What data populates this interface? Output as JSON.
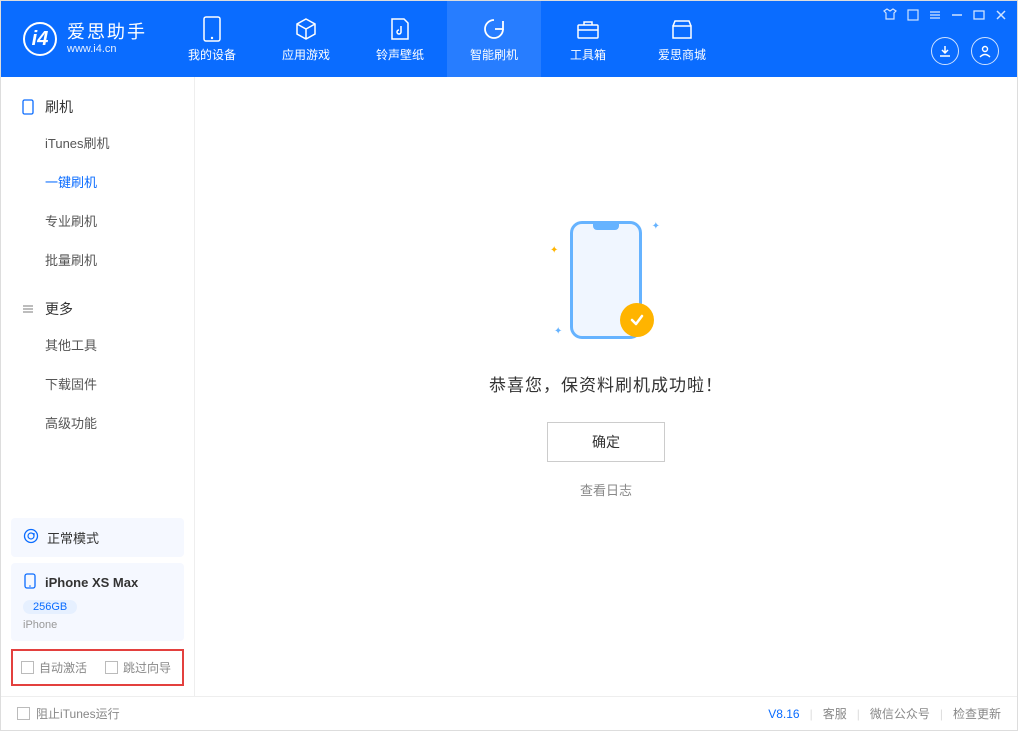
{
  "brand": {
    "name": "爱思助手",
    "url": "www.i4.cn"
  },
  "tabs": [
    {
      "label": "我的设备"
    },
    {
      "label": "应用游戏"
    },
    {
      "label": "铃声壁纸"
    },
    {
      "label": "智能刷机"
    },
    {
      "label": "工具箱"
    },
    {
      "label": "爱思商城"
    }
  ],
  "sidebar": {
    "section1": {
      "title": "刷机",
      "items": [
        "iTunes刷机",
        "一键刷机",
        "专业刷机",
        "批量刷机"
      ]
    },
    "section2": {
      "title": "更多",
      "items": [
        "其他工具",
        "下载固件",
        "高级功能"
      ]
    }
  },
  "device": {
    "mode": "正常模式",
    "name": "iPhone XS Max",
    "storage": "256GB",
    "type": "iPhone"
  },
  "checkboxes": {
    "auto_activate": "自动激活",
    "skip_guide": "跳过向导"
  },
  "main": {
    "success": "恭喜您，保资料刷机成功啦！",
    "ok": "确定",
    "view_log": "查看日志"
  },
  "footer": {
    "block_itunes": "阻止iTunes运行",
    "version": "V8.16",
    "links": {
      "service": "客服",
      "wechat": "微信公众号",
      "update": "检查更新"
    }
  }
}
